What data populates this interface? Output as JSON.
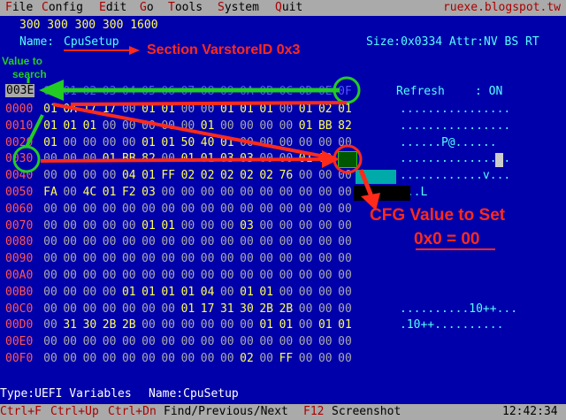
{
  "menu": {
    "items": [
      {
        "hot": "F",
        "rest": "ile"
      },
      {
        "hot": "C",
        "rest": "onfig"
      },
      {
        "hot": "E",
        "rest": "dit"
      },
      {
        "hot": "G",
        "rest": "o"
      },
      {
        "hot": "T",
        "rest": "ools"
      },
      {
        "hot": "S",
        "rest": "ystem"
      },
      {
        "hot": "Q",
        "rest": "uit"
      }
    ],
    "site": "ruexe.blogspot.tw"
  },
  "header": {
    "numbers": "300 300 300 300 1600",
    "name_label": "Name:",
    "name_value": "CpuSetup",
    "size_info": "Size:0x0334 Attr:NV BS RT"
  },
  "grid": {
    "offset_label": "003E",
    "column_headers": [
      "00",
      "01",
      "02",
      "03",
      "04",
      "05",
      "06",
      "07",
      "08",
      "09",
      "0A",
      "0B",
      "0C",
      "0D",
      "0E",
      "0F"
    ],
    "rows": [
      {
        "addr": "0000",
        "bytes": [
          "01",
          "0A",
          "17",
          "17",
          "00",
          "01",
          "01",
          "00",
          "00",
          "01",
          "01",
          "01",
          "00",
          "01",
          "02",
          "01"
        ],
        "ascii": "................"
      },
      {
        "addr": "0010",
        "bytes": [
          "01",
          "01",
          "01",
          "00",
          "00",
          "00",
          "00",
          "00",
          "01",
          "00",
          "00",
          "00",
          "00",
          "01",
          "BB",
          "82"
        ],
        "ascii": "................"
      },
      {
        "addr": "0020",
        "bytes": [
          "01",
          "00",
          "00",
          "00",
          "00",
          "01",
          "01",
          "50",
          "40",
          "01",
          "00",
          "00",
          "00",
          "00",
          "00",
          "00"
        ],
        "ascii": "......P@......"
      },
      {
        "addr": "0030",
        "bytes": [
          "00",
          "00",
          "00",
          "01",
          "BB",
          "82",
          "00",
          "01",
          "01",
          "03",
          "03",
          "00",
          "00",
          "01",
          "00",
          "00"
        ],
        "ascii": "................"
      },
      {
        "addr": "0040",
        "bytes": [
          "00",
          "00",
          "00",
          "00",
          "04",
          "01",
          "FF",
          "02",
          "02",
          "02",
          "02",
          "02",
          "76",
          "00",
          "00",
          "00"
        ],
        "ascii": "............v..."
      },
      {
        "addr": "0050",
        "bytes": [
          "FA",
          "00",
          "4C",
          "01",
          "F2",
          "03",
          "00",
          "00",
          "00",
          "00",
          "00",
          "00",
          "00",
          "00",
          "00",
          "00"
        ],
        "ascii": "...L"
      },
      {
        "addr": "0060",
        "bytes": [
          "00",
          "00",
          "00",
          "00",
          "00",
          "00",
          "00",
          "00",
          "00",
          "00",
          "00",
          "00",
          "00",
          "00",
          "00",
          "00"
        ],
        "ascii": ""
      },
      {
        "addr": "0070",
        "bytes": [
          "00",
          "00",
          "00",
          "00",
          "00",
          "01",
          "01",
          "00",
          "00",
          "00",
          "03",
          "00",
          "00",
          "00",
          "00",
          "00"
        ],
        "ascii": ""
      },
      {
        "addr": "0080",
        "bytes": [
          "00",
          "00",
          "00",
          "00",
          "00",
          "00",
          "00",
          "00",
          "00",
          "00",
          "00",
          "00",
          "00",
          "00",
          "00",
          "00"
        ],
        "ascii": ""
      },
      {
        "addr": "0090",
        "bytes": [
          "00",
          "00",
          "00",
          "00",
          "00",
          "00",
          "00",
          "00",
          "00",
          "00",
          "00",
          "00",
          "00",
          "00",
          "00",
          "00"
        ],
        "ascii": ""
      },
      {
        "addr": "00A0",
        "bytes": [
          "00",
          "00",
          "00",
          "00",
          "00",
          "00",
          "00",
          "00",
          "00",
          "00",
          "00",
          "00",
          "00",
          "00",
          "00",
          "00"
        ],
        "ascii": ""
      },
      {
        "addr": "00B0",
        "bytes": [
          "00",
          "00",
          "00",
          "00",
          "01",
          "01",
          "01",
          "01",
          "04",
          "00",
          "01",
          "01",
          "00",
          "00",
          "00",
          "00"
        ],
        "ascii": ""
      },
      {
        "addr": "00C0",
        "bytes": [
          "00",
          "00",
          "00",
          "00",
          "00",
          "00",
          "00",
          "01",
          "17",
          "31",
          "30",
          "2B",
          "2B",
          "00",
          "00",
          "00"
        ],
        "ascii": "..........10++..."
      },
      {
        "addr": "00D0",
        "bytes": [
          "00",
          "31",
          "30",
          "2B",
          "2B",
          "00",
          "00",
          "00",
          "00",
          "00",
          "00",
          "01",
          "01",
          "00",
          "01",
          "01"
        ],
        "ascii": ".10++.........."
      },
      {
        "addr": "00E0",
        "bytes": [
          "00",
          "00",
          "00",
          "00",
          "00",
          "00",
          "00",
          "00",
          "00",
          "00",
          "00",
          "00",
          "00",
          "00",
          "00",
          "00"
        ],
        "ascii": ""
      },
      {
        "addr": "00F0",
        "bytes": [
          "00",
          "00",
          "00",
          "00",
          "00",
          "00",
          "00",
          "00",
          "00",
          "00",
          "02",
          "00",
          "FF",
          "00",
          "00",
          "00"
        ],
        "ascii": ""
      }
    ]
  },
  "refresh": {
    "label": "Refresh",
    "value": ": ON"
  },
  "annotations": {
    "section": "Section VarstoreID 0x3",
    "value_to_search_1": "Value to",
    "value_to_search_2": "search",
    "cfg_1": "CFG Value to Set",
    "cfg_2": "0x0 = 00"
  },
  "status": {
    "type_label": "Type:UEFI Variables",
    "name_label": "Name:CpuSetup"
  },
  "keys": {
    "k1": "Ctrl+F",
    "k2": "Ctrl+Up",
    "k3": "Ctrl+Dn",
    "k_desc": "Find/Previous/Next",
    "k4": "F12",
    "k4_desc": "Screenshot",
    "time": "12:42:34"
  },
  "colors": {
    "background": "#0000aa",
    "menu_bar": "#aaaaaa",
    "hex_value": "#ffff55",
    "address": "#ff5555",
    "column_header": "#5555ff",
    "ascii": "#55ffff",
    "annotation_red": "#ff2a1a",
    "annotation_green": "#22cc22"
  }
}
